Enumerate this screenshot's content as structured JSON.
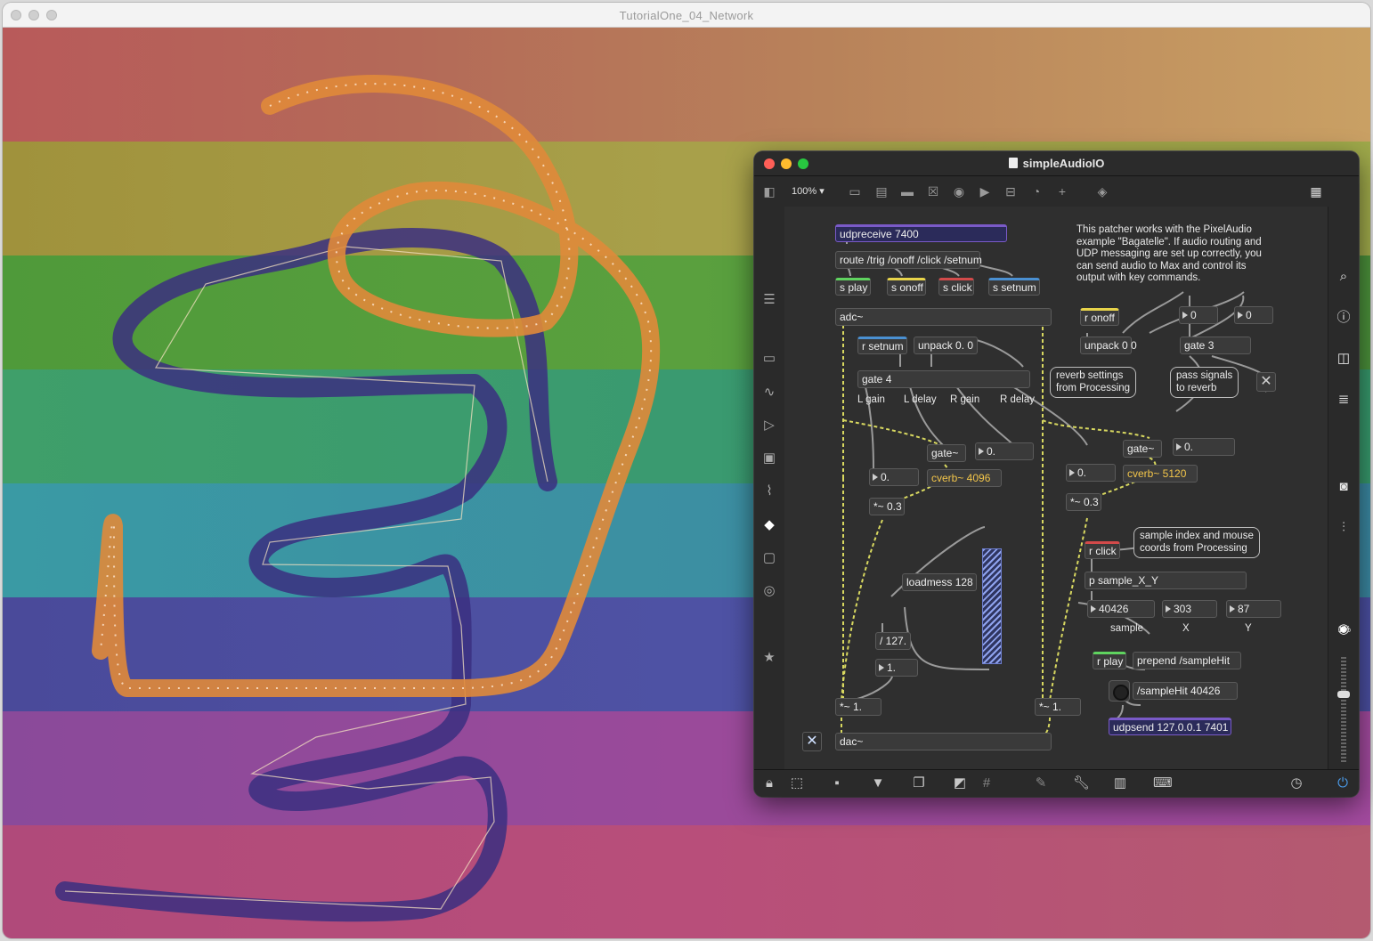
{
  "window": {
    "title": "TutorialOne_04_Network"
  },
  "max_window": {
    "title": "simpleAudioIO",
    "zoom": "100%",
    "volume_percent": "1%",
    "traffic_light_colors": [
      "#ff5f57",
      "#febc2e",
      "#28c840"
    ]
  },
  "patcher": {
    "objects": {
      "udpreceive": "udpreceive 7400",
      "route": "route /trig /onoff /click /setnum",
      "s_play": "s play",
      "s_onoff": "s onoff",
      "s_click": "s click",
      "s_setnum": "s setnum",
      "adc": "adc~",
      "r_setnum": "r setnum",
      "unpack_gate": "unpack 0. 0",
      "gate4": "gate 4",
      "r_onoff": "r onoff",
      "unpack_onoff": "unpack 0 0",
      "gate3": "gate 3",
      "num_gate_a": "0",
      "num_gate_b": "0",
      "gate_sig_l": "gate~",
      "gate_sig_r": "gate~",
      "cverb_l": "cverb~ 4096",
      "cverb_r": "cverb~ 5120",
      "num_l_delay": "0.",
      "num_r_delay": "0.",
      "num_l_gain": "0.",
      "num_r_gain": "0.",
      "mul_l": "*~ 0.3",
      "mul_r": "*~ 0.3",
      "loadmess": "loadmess 128",
      "div127": "/ 127.",
      "num_one": "1.",
      "mul_out_l": "*~ 1.",
      "mul_out_r": "*~ 1.",
      "dac": "dac~",
      "r_click": "r click",
      "p_sample": "p sample_X_Y",
      "num_sample": "40426",
      "num_x": "303",
      "num_y": "87",
      "r_play": "r play",
      "prepend": "prepend /sampleHit",
      "msg_samplehit": "/sampleHit 40426",
      "udpsend": "udpsend 127.0.0.1 7401"
    },
    "labels": {
      "l_gain": "L gain",
      "l_delay": "L delay",
      "r_gain": "R gain",
      "r_delay": "R delay",
      "sample": "sample",
      "x": "X",
      "y": "Y"
    },
    "comments": {
      "intro": [
        "This patcher works with the PixelAudio",
        "example \"Bagatelle\". If audio routing and",
        "UDP messaging are set up correctly, you",
        "can send audio to Max and control its",
        "output with key commands."
      ],
      "reverb_settings": [
        "reverb settings",
        "from Processing"
      ],
      "pass_signals": [
        "pass signals",
        "to reverb"
      ],
      "sample_index": [
        "sample index and mouse",
        "coords from Processing"
      ]
    },
    "colors": {
      "udp": "#7a5ac8",
      "green": "#5fd35f",
      "yellow": "#e8d44a",
      "red": "#d24a4a",
      "blue": "#4a90d2",
      "signal_wire": "#d8d860",
      "control_wire": "#9a9a9a"
    }
  },
  "canvas": {
    "band_colors": [
      "#b85a5a",
      "#a09a3c",
      "#4f9a3a",
      "#3f9f6a",
      "#3a9aa4",
      "#4a4a9a",
      "#8a4a9a",
      "#b04a7a"
    ],
    "stroke_colors": {
      "orange": "#e08a3a",
      "purple": "#3b2f80"
    }
  }
}
